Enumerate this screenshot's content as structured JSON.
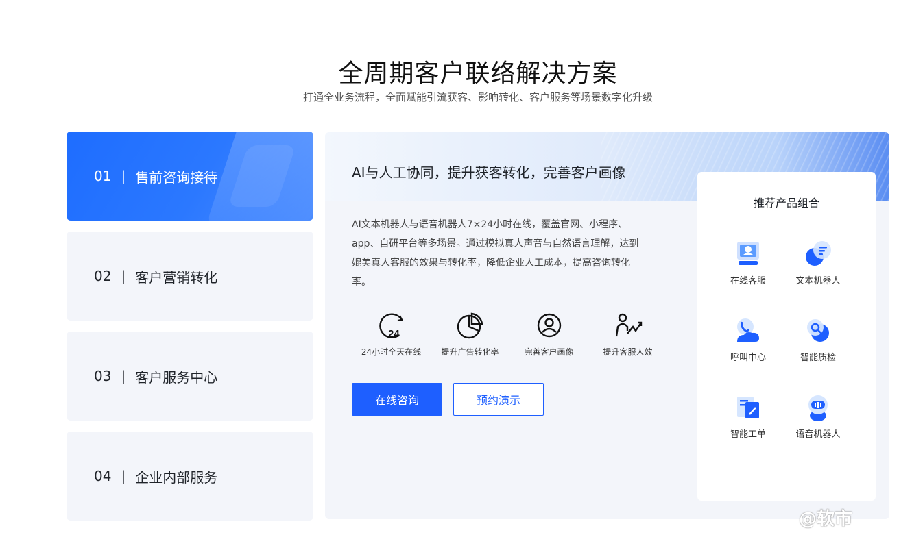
{
  "header": {
    "title": "全周期客户联络解决方案",
    "subtitle": "打通全业务流程，全面赋能引流获客、影响转化、客户服务等场景数字化升级"
  },
  "tabs": [
    {
      "num": "01",
      "sep": "|",
      "label": "售前咨询接待",
      "active": true
    },
    {
      "num": "02",
      "sep": "|",
      "label": "客户营销转化",
      "active": false
    },
    {
      "num": "03",
      "sep": "|",
      "label": "客户服务中心",
      "active": false
    },
    {
      "num": "04",
      "sep": "|",
      "label": "企业内部服务",
      "active": false
    }
  ],
  "panel": {
    "title": "AI与人工协同，提升获客转化，完善客户画像",
    "description": "AI文本机器人与语音机器人7×24小时在线，覆盖官网、小程序、app、自研平台等多场景。通过模拟真人声音与自然语言理解，达到媲美真人客服的效果与转化率，降低企业人工成本，提高咨询转化率。",
    "features": [
      {
        "icon": "clock-24-icon",
        "label": "24小时全天在线"
      },
      {
        "icon": "pie-chart-icon",
        "label": "提升广告转化率"
      },
      {
        "icon": "user-profile-icon",
        "label": "完善客户画像"
      },
      {
        "icon": "person-growth-icon",
        "label": "提升客服人效"
      }
    ],
    "primary_button": "在线咨询",
    "secondary_button": "预约演示"
  },
  "recommend": {
    "title": "推荐产品组合",
    "items": [
      {
        "icon": "online-service-icon",
        "label": "在线客服"
      },
      {
        "icon": "text-robot-icon",
        "label": "文本机器人"
      },
      {
        "icon": "call-center-icon",
        "label": "呼叫中心"
      },
      {
        "icon": "quality-check-icon",
        "label": "智能质检"
      },
      {
        "icon": "work-order-icon",
        "label": "智能工单"
      },
      {
        "icon": "voice-robot-icon",
        "label": "语音机器人"
      }
    ]
  },
  "watermark": "@软市",
  "colors": {
    "accent": "#1e5fff",
    "tab_bg": "#f3f5fa"
  }
}
